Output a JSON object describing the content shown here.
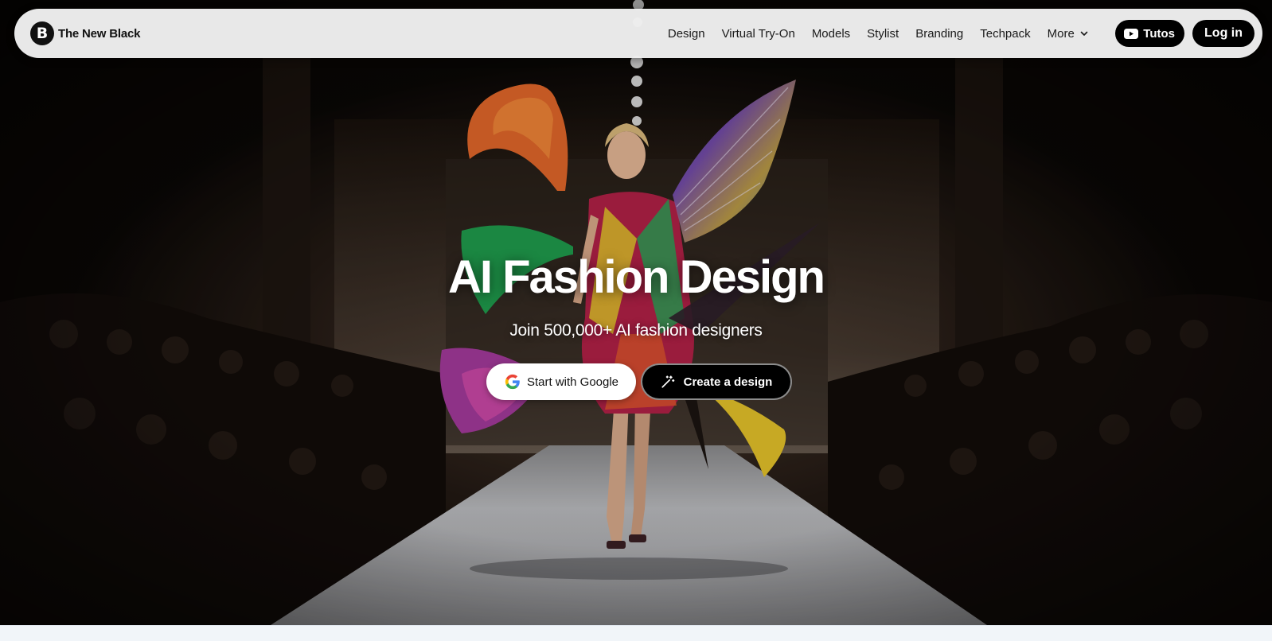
{
  "brand": {
    "logo_letter": "B",
    "name": "The New Black"
  },
  "nav": {
    "links": [
      "Design",
      "Virtual Try-On",
      "Models",
      "Stylist",
      "Branding",
      "Techpack"
    ],
    "more_label": "More",
    "tutos_label": "Tutos",
    "login_label": "Log in"
  },
  "hero": {
    "title": "AI Fashion Design",
    "subtitle": "Join 500,000+ AI fashion designers",
    "google_button_label": "Start with Google",
    "create_button_label": "Create a design"
  },
  "colors": {
    "accent": "#000000",
    "navbar_bg": "#f0f0f0",
    "hero_text": "#ffffff"
  },
  "icons": {
    "brand": "brand-logo",
    "more": "chevron-down-icon",
    "tutos": "youtube-icon",
    "google": "google-icon",
    "create": "magic-wand-icon"
  }
}
